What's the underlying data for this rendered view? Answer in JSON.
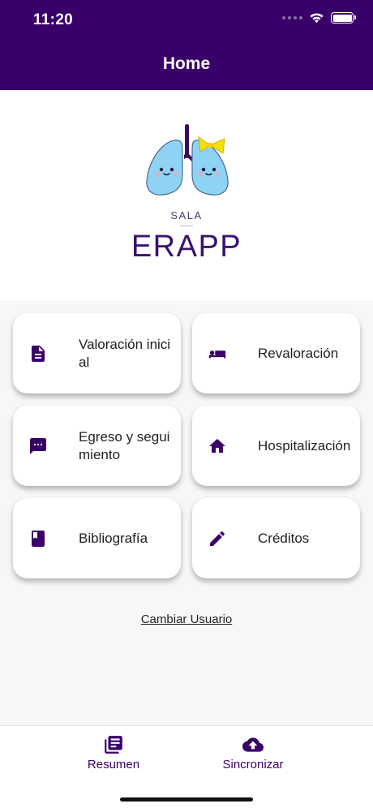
{
  "status_bar": {
    "time": "11:20"
  },
  "nav": {
    "title": "Home"
  },
  "logo": {
    "sala": "SALA",
    "app_name": "ERAPP"
  },
  "menu": {
    "valoracion": "Valoración inicial",
    "revaloracion": "Revaloración",
    "egreso": "Egreso y seguimiento",
    "hospitalizacion": "Hospitalización",
    "bibliografia": "Bibliografía",
    "creditos": "Créditos"
  },
  "links": {
    "change_user": "Cambiar Usuario"
  },
  "tabs": {
    "resumen": "Resumen",
    "sincronizar": "Sincronizar"
  },
  "colors": {
    "primary": "#3a006a",
    "lung": "#8fd3f4",
    "bow": "#f5e000"
  },
  "icons": [
    "description-icon",
    "hotel-icon",
    "chat-icon",
    "home-icon",
    "book-icon",
    "edit-icon",
    "summary-icon",
    "cloud-upload-icon"
  ]
}
